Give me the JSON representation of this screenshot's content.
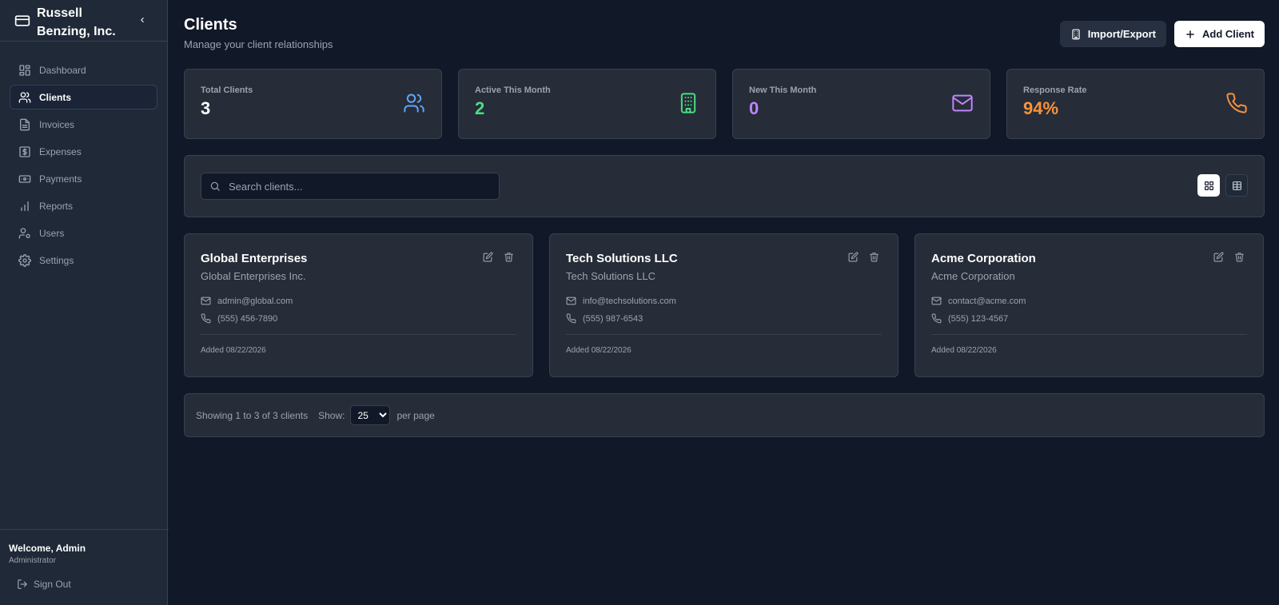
{
  "app": {
    "name": "Russell Benzing, Inc.",
    "icon": "credit-card-icon"
  },
  "sidebar": {
    "items": [
      {
        "label": "Dashboard",
        "icon": "dashboard-icon",
        "active": false
      },
      {
        "label": "Clients",
        "icon": "users-icon",
        "active": true
      },
      {
        "label": "Invoices",
        "icon": "file-icon",
        "active": false
      },
      {
        "label": "Expenses",
        "icon": "dollar-icon",
        "active": false
      },
      {
        "label": "Payments",
        "icon": "banknote-icon",
        "active": false
      },
      {
        "label": "Reports",
        "icon": "bar-chart-icon",
        "active": false
      },
      {
        "label": "Users",
        "icon": "user-cog-icon",
        "active": false
      },
      {
        "label": "Settings",
        "icon": "gear-icon",
        "active": false
      }
    ],
    "user": {
      "welcome": "Welcome, Admin",
      "role": "Administrator",
      "sign_out": "Sign Out"
    }
  },
  "header": {
    "title": "Clients",
    "subtitle": "Manage your client relationships",
    "import_export_label": "Import/Export",
    "add_client_label": "Add Client"
  },
  "stats": [
    {
      "label": "Total Clients",
      "value": "3",
      "color": "#ffffff",
      "icon": "users-icon",
      "icon_color": "#60a5fa"
    },
    {
      "label": "Active This Month",
      "value": "2",
      "color": "#4ade80",
      "icon": "building-icon",
      "icon_color": "#4ade80"
    },
    {
      "label": "New This Month",
      "value": "0",
      "color": "#c084fc",
      "icon": "mail-icon",
      "icon_color": "#c084fc"
    },
    {
      "label": "Response Rate",
      "value": "94%",
      "color": "#fb923c",
      "icon": "phone-icon",
      "icon_color": "#fb923c"
    }
  ],
  "search": {
    "placeholder": "Search clients...",
    "value": ""
  },
  "clients": [
    {
      "name": "Global Enterprises",
      "company": "Global Enterprises Inc.",
      "email": "admin@global.com",
      "phone": "(555) 456-7890",
      "added": "Added 08/22/2026"
    },
    {
      "name": "Tech Solutions LLC",
      "company": "Tech Solutions LLC",
      "email": "info@techsolutions.com",
      "phone": "(555) 987-6543",
      "added": "Added 08/22/2026"
    },
    {
      "name": "Acme Corporation",
      "company": "Acme Corporation",
      "email": "contact@acme.com",
      "phone": "(555) 123-4567",
      "added": "Added 08/22/2026"
    }
  ],
  "pagination": {
    "summary": "Showing 1 to 3 of 3 clients",
    "show_label": "Show:",
    "per_page_value": "25",
    "per_page_suffix": "per page"
  }
}
